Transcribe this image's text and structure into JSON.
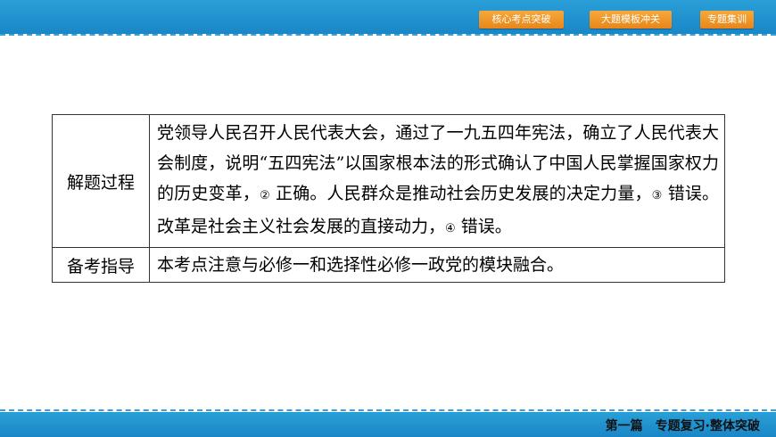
{
  "header": {
    "buttons": [
      "核心考点突破",
      "大题模板冲关",
      "专题集训"
    ]
  },
  "footer": {
    "text": "第一篇　专题复习·整体突破"
  },
  "table": {
    "rows": [
      {
        "label": "解题过程",
        "parts": [
          "党领导人民召开人民代表大会，通过了一九五四年宪法，确立了人民代表大会制度，说明“五四宪法”以国家根本法的形式确认了中国人民掌握国家权力的历史变革，",
          "②",
          " 正确。人民群众是推动社会历史发展的决定力量，",
          "③",
          " 错误。改革是社会主义社会发展的直接动力，",
          "④",
          " 错误。"
        ]
      },
      {
        "label": "备考指导",
        "text": "本考点注意与必修一和选择性必修一政党的模块融合。"
      }
    ]
  },
  "colors": {
    "bar": "#1e8fcf",
    "button": "#f0961f"
  }
}
